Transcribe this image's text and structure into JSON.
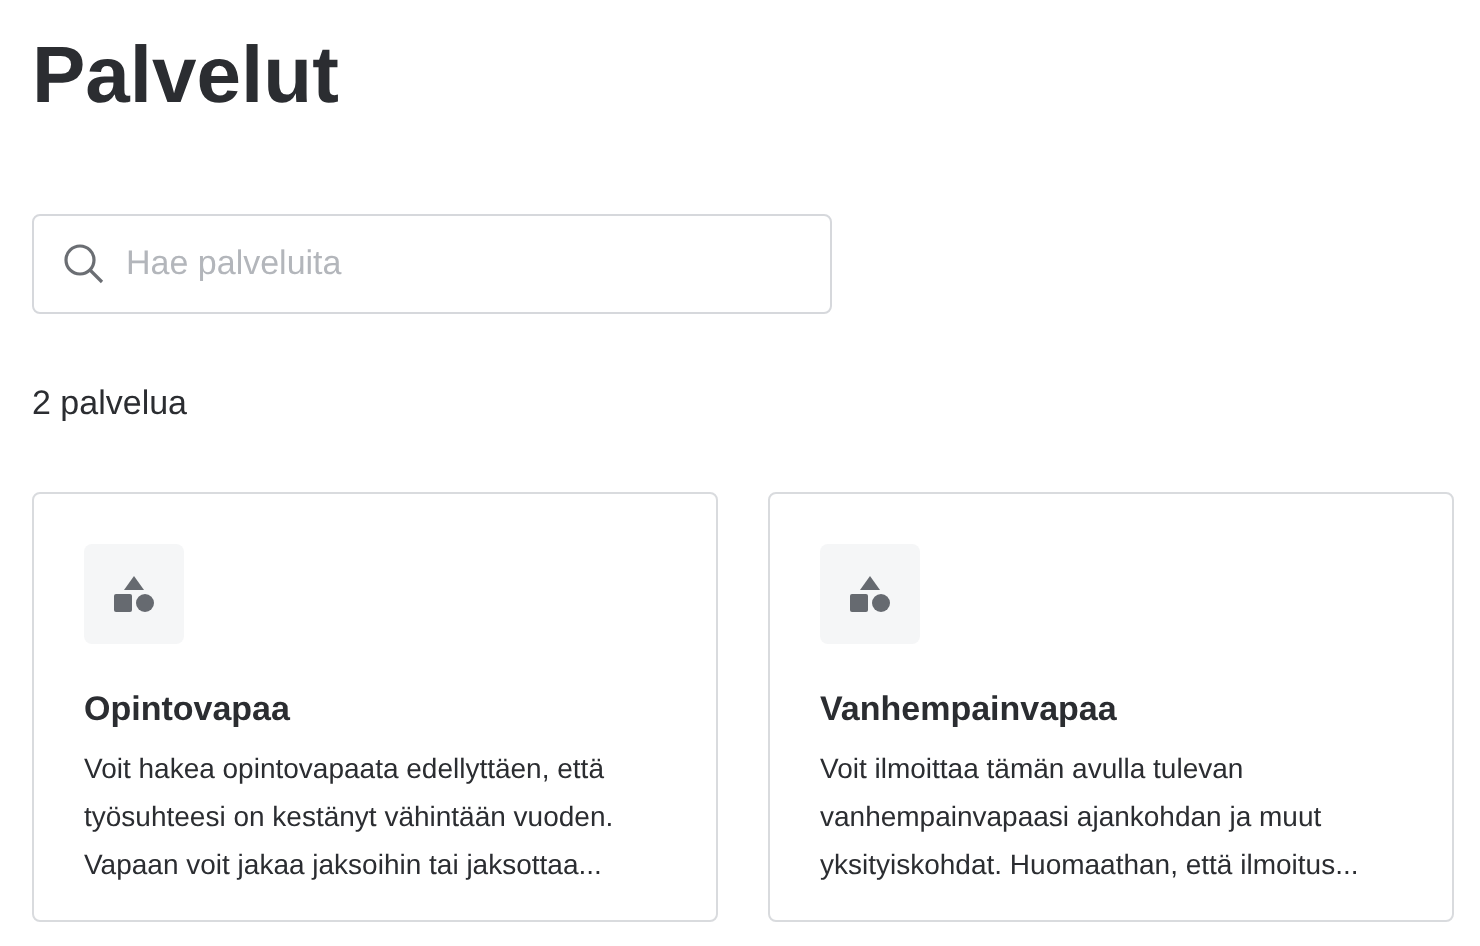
{
  "page": {
    "title": "Palvelut"
  },
  "search": {
    "placeholder": "Hae palveluita"
  },
  "result_count": "2 palvelua",
  "services": [
    {
      "title": "Opintovapaa",
      "description": "Voit hakea opintovapaata edellyttäen, että\ntyösuhteesi on kestänyt vähintään vuoden.\nVapaan voit jakaa jaksoihin tai jaksottaa..."
    },
    {
      "title": "Vanhempainvapaa",
      "description": "Voit ilmoittaa tämän avulla tulevan\nvanhempainvapaasi ajankohdan ja muut\nyksityiskohdat. Huomaathan, että ilmoitus..."
    }
  ]
}
